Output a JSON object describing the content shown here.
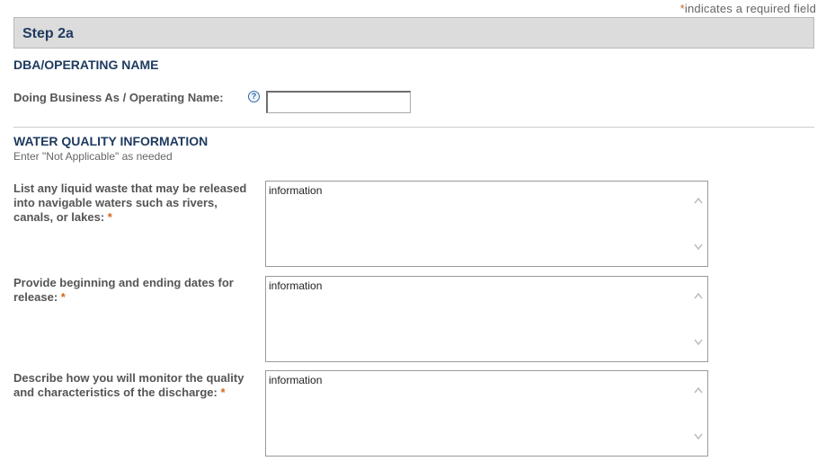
{
  "required_note": {
    "star": "*",
    "text": "indicates a required field"
  },
  "step": {
    "title": "Step 2a"
  },
  "dba_section": {
    "heading": "DBA/OPERATING NAME",
    "field_label": "Doing Business As / Operating Name:",
    "help_icon": "question-circle-icon",
    "value": ""
  },
  "water_section": {
    "heading": "WATER QUALITY INFORMATION",
    "subtext": "Enter \"Not Applicable\" as needed",
    "fields": [
      {
        "label_lines": [
          "List any liquid waste that may be released",
          "into navigable waters such as rivers,",
          "canals, or lakes:"
        ],
        "required_star": "*",
        "value": "information"
      },
      {
        "label_lines": [
          "Provide beginning and ending dates for",
          "release:"
        ],
        "required_star": "*",
        "value": "information"
      },
      {
        "label_lines": [
          "Describe how you will monitor the quality",
          "and characteristics of the discharge:"
        ],
        "required_star": "*",
        "value": "information"
      }
    ]
  },
  "colors": {
    "heading": "#1e3a5f",
    "required_star": "#d2691e",
    "step_bar_bg": "#dcdcdc"
  }
}
